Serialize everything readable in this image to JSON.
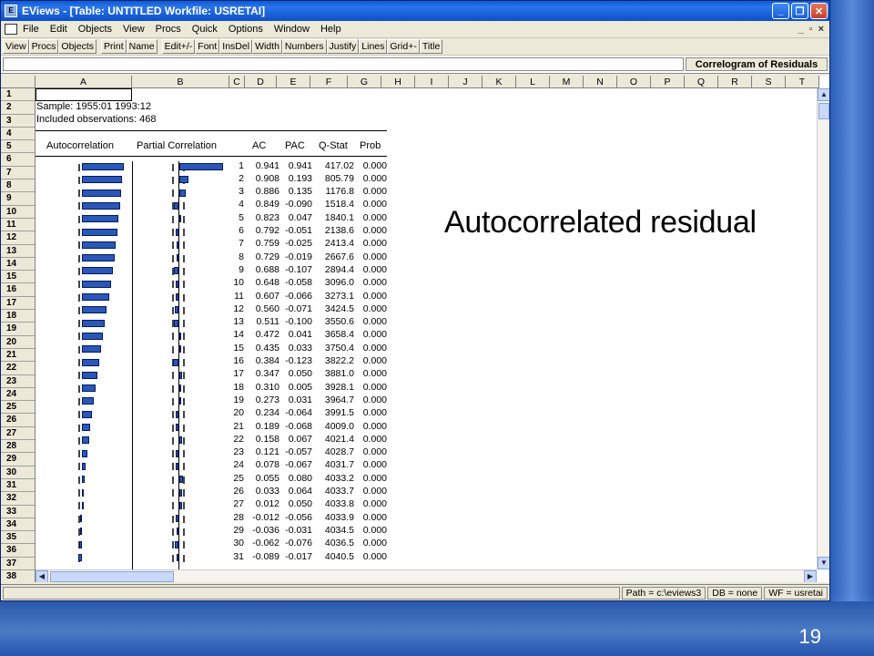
{
  "window": {
    "title": "EViews - [Table: UNTITLED    Workfile: USRETAI]",
    "icon_label": "E"
  },
  "menu": {
    "items": [
      "File",
      "Edit",
      "Objects",
      "View",
      "Procs",
      "Quick",
      "Options",
      "Window",
      "Help"
    ],
    "right_controls": [
      "_",
      "▫",
      "×"
    ]
  },
  "toolbar": {
    "group1": [
      "View",
      "Procs",
      "Objects"
    ],
    "group2": [
      "Print",
      "Name"
    ],
    "group3": [
      "Edit+/-",
      "Font",
      "InsDel",
      "Width",
      "Numbers",
      "Justify",
      "Lines",
      "Grid+-",
      "Title"
    ]
  },
  "formula_bar": {
    "label": "Correlogram of Residuals"
  },
  "columns": [
    "A",
    "B",
    "C",
    "D",
    "E",
    "F",
    "G",
    "H",
    "I",
    "J",
    "K",
    "L",
    "M",
    "N",
    "O",
    "P",
    "Q",
    "R",
    "S",
    "T"
  ],
  "rows": [
    "1",
    "2",
    "3",
    "4",
    "5",
    "6",
    "7",
    "8",
    "9",
    "10",
    "11",
    "12",
    "13",
    "14",
    "15",
    "16",
    "17",
    "18",
    "19",
    "20",
    "21",
    "22",
    "23",
    "24",
    "25",
    "26",
    "27",
    "28",
    "29",
    "30",
    "31",
    "32",
    "33",
    "34",
    "35",
    "36",
    "37",
    "38"
  ],
  "sheet": {
    "sample_text": "Sample: 1955:01 1993:12",
    "obs_text": "Included observations: 468",
    "headers": {
      "autocorrelation": "Autocorrelation",
      "partial_correlation": "Partial Correlation",
      "ac": "AC",
      "pac": "PAC",
      "qstat": "Q-Stat",
      "prob": "Prob"
    }
  },
  "correlogram": {
    "lags": [
      "1",
      "2",
      "3",
      "4",
      "5",
      "6",
      "7",
      "8",
      "9",
      "10",
      "11",
      "12",
      "13",
      "14",
      "15",
      "16",
      "17",
      "18",
      "19",
      "20",
      "21",
      "22",
      "23",
      "24",
      "25",
      "26",
      "27",
      "28",
      "29",
      "30",
      "31"
    ],
    "ac": [
      "0.941",
      "0.908",
      "0.886",
      "0.849",
      "0.823",
      "0.792",
      "0.759",
      "0.729",
      "0.688",
      "0.648",
      "0.607",
      "0.560",
      "0.511",
      "0.472",
      "0.435",
      "0.384",
      "0.347",
      "0.310",
      "0.273",
      "0.234",
      "0.189",
      "0.158",
      "0.121",
      "0.078",
      "0.055",
      "0.033",
      "0.012",
      "-0.012",
      "-0.036",
      "-0.062",
      "-0.089"
    ],
    "pac": [
      "0.941",
      "0.193",
      "0.135",
      "-0.090",
      "0.047",
      "-0.051",
      "-0.025",
      "-0.019",
      "-0.107",
      "-0.058",
      "-0.066",
      "-0.071",
      "-0.100",
      "0.041",
      "0.033",
      "-0.123",
      "0.050",
      "0.005",
      "0.031",
      "-0.064",
      "-0.068",
      "0.067",
      "-0.057",
      "-0.067",
      "0.080",
      "0.064",
      "0.050",
      "-0.056",
      "-0.031",
      "-0.076",
      "-0.017"
    ],
    "qstat": [
      "417.02",
      "805.79",
      "1176.8",
      "1518.4",
      "1840.1",
      "2138.6",
      "2413.4",
      "2667.6",
      "2894.4",
      "3096.0",
      "3273.1",
      "3424.5",
      "3550.6",
      "3658.4",
      "3750.4",
      "3822.2",
      "3881.0",
      "3928.1",
      "3964.7",
      "3991.5",
      "4009.0",
      "4021.4",
      "4028.7",
      "4031.7",
      "4033.2",
      "4033.7",
      "4033.8",
      "4033.9",
      "4034.5",
      "4036.5",
      "4040.5"
    ],
    "prob": [
      "0.000",
      "0.000",
      "0.000",
      "0.000",
      "0.000",
      "0.000",
      "0.000",
      "0.000",
      "0.000",
      "0.000",
      "0.000",
      "0.000",
      "0.000",
      "0.000",
      "0.000",
      "0.000",
      "0.000",
      "0.000",
      "0.000",
      "0.000",
      "0.000",
      "0.000",
      "0.000",
      "0.000",
      "0.000",
      "0.000",
      "0.000",
      "0.000",
      "0.000",
      "0.000",
      "0.000"
    ]
  },
  "annotation": "Autocorrelated  residual",
  "statusbar": {
    "path": "Path = c:\\eviews3",
    "db": "DB = none",
    "wf": "WF = usretai"
  },
  "slide_number": "19",
  "colors": {
    "bar": "#2b57b5",
    "titlebar": "#0a5bd8",
    "slide_bg": "#1f4fa8"
  }
}
